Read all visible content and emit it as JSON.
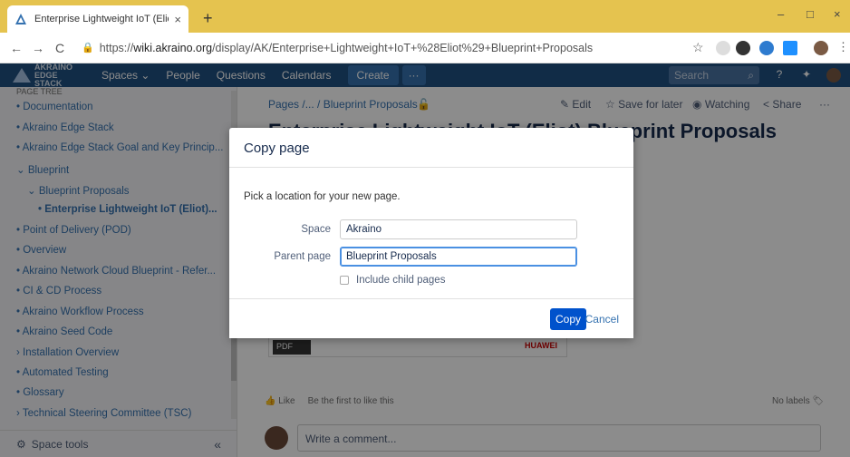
{
  "browser": {
    "tab_title": "Enterprise Lightweight IoT (Eliot)",
    "close_tab": "×",
    "new_tab": "+",
    "win_min": "–",
    "win_max": "□",
    "win_close": "×",
    "back": "←",
    "forward": "→",
    "reload": "C",
    "url_prefix": "https://",
    "url_host": "wiki.akraino.org",
    "url_path": "/display/AK/Enterprise+Lightweight+IoT+%28Eliot%29+Blueprint+Proposals",
    "star": "☆"
  },
  "app": {
    "logo_line1": "AKRAINO",
    "logo_line2": "EDGE STACK",
    "nav": [
      "Spaces ⌄",
      "People",
      "Questions",
      "Calendars"
    ],
    "create": "Create",
    "more": "···",
    "search_placeholder": "Search",
    "search_icon": "⌕"
  },
  "sidebar": {
    "header": "PAGE TREE",
    "items": [
      {
        "label": "• Documentation"
      },
      {
        "label": "• Akraino Edge Stack"
      },
      {
        "label": "• Akraino Edge Stack Goal and Key Princip..."
      },
      {
        "label": "⌄ Blueprint"
      },
      {
        "label": "⌄ Blueprint Proposals"
      },
      {
        "label": "• Enterprise Lightweight IoT (Eliot)..."
      },
      {
        "label": "• Point of Delivery (POD)"
      },
      {
        "label": "• Overview"
      },
      {
        "label": "• Akraino Network Cloud Blueprint - Refer..."
      },
      {
        "label": "• CI & CD Process"
      },
      {
        "label": "• Akraino Workflow Process"
      },
      {
        "label": "• Akraino Seed Code"
      },
      {
        "label": "› Installation Overview"
      },
      {
        "label": "• Automated Testing"
      },
      {
        "label": "• Glossary"
      },
      {
        "label": "› Technical Steering Committee (TSC)"
      }
    ],
    "space_tools": "Space tools",
    "collapse": "«"
  },
  "content": {
    "breadcrumb": "Pages /... / Blueprint Proposals",
    "edit": "Edit",
    "save_for_later": "Save for later",
    "watching": "Watching",
    "share": "Share",
    "more": "···",
    "title": "Enterprise Lightweight IoT (Eliot) Blueprint Proposals",
    "pdf_label": "PDF",
    "huawei_label": "HUAWEI",
    "like": "Like",
    "like_hint": "Be the first to like this",
    "no_labels": "No labels",
    "comment_placeholder": "Write a comment..."
  },
  "dialog": {
    "title": "Copy page",
    "description": "Pick a location for your new page.",
    "space_label": "Space",
    "space_value": "Akraino",
    "parent_label": "Parent page",
    "parent_value": "Blueprint Proposals",
    "include_children": "Include child pages",
    "copy": "Copy",
    "cancel": "Cancel"
  }
}
